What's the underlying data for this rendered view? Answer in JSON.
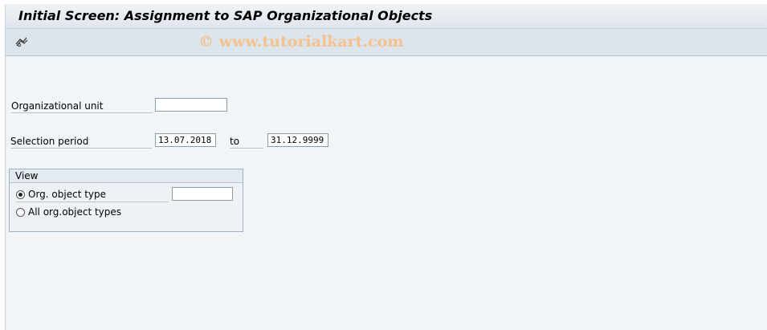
{
  "window": {
    "title": "Initial Screen: Assignment to SAP Organizational Objects"
  },
  "toolbar": {
    "execute_icon": "execute-icon",
    "watermark": "© www.tutorialkart.com"
  },
  "form": {
    "org_unit": {
      "label": "Organizational unit",
      "value": ""
    },
    "selection_period": {
      "label": "Selection period",
      "from": "13.07.2018",
      "to_label": "to",
      "to": "31.12.9999"
    }
  },
  "view_group": {
    "title": "View",
    "options": [
      {
        "label": "Org. object type",
        "selected": true
      },
      {
        "label": "All org.object types",
        "selected": false
      }
    ],
    "org_object_type_value": ""
  }
}
